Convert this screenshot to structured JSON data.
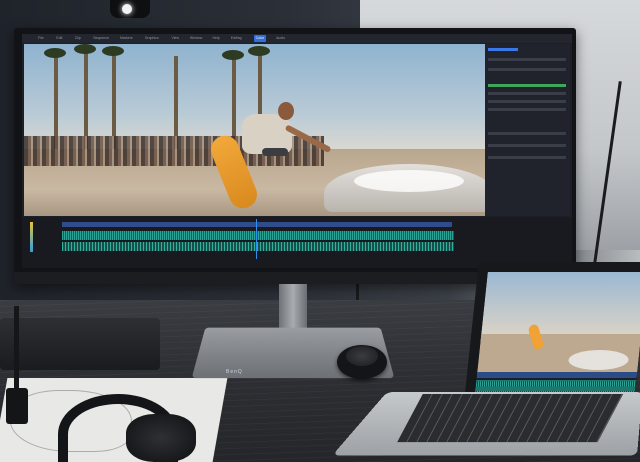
{
  "scene": {
    "description_alt": "",
    "monitor": {
      "base_label": "BenQ"
    },
    "editor": {
      "menu": [
        "File",
        "Edit",
        "Clip",
        "Sequence",
        "Markers",
        "Graphics",
        "View",
        "Window",
        "Help",
        "Editing",
        "Color",
        "Audio"
      ],
      "active_menu_index": 10
    }
  },
  "colors": {
    "accent": "#2f6fe0",
    "audio_waveform": "#2aa394",
    "skateboard": "#f2a83a"
  }
}
